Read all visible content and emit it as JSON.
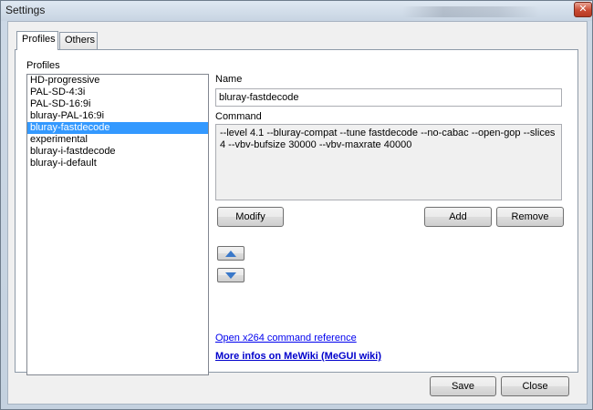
{
  "window": {
    "title": "Settings",
    "close_glyph": "✕"
  },
  "tabs": [
    {
      "label": "Profiles"
    },
    {
      "label": "Others"
    }
  ],
  "profiles_panel": {
    "group_label": "Profiles",
    "items": [
      "HD-progressive",
      "PAL-SD-4:3i",
      "PAL-SD-16:9i",
      "bluray-PAL-16:9i",
      "bluray-fastdecode",
      "experimental",
      "bluray-i-fastdecode",
      "bluray-i-default"
    ],
    "selected_index": 4
  },
  "editor": {
    "name_label": "Name",
    "name_value": "bluray-fastdecode",
    "command_label": "Command",
    "command_value": "--level 4.1 --bluray-compat --tune fastdecode --no-cabac --open-gop --slices 4 --vbv-bufsize 30000 --vbv-maxrate 40000"
  },
  "buttons": {
    "modify": "Modify",
    "add": "Add",
    "remove": "Remove",
    "save": "Save",
    "close": "Close"
  },
  "links": {
    "x264_reference": "Open x264 command reference",
    "wiki": "More infos on MeWiki (MeGUI wiki)"
  },
  "colors": {
    "selection": "#3399ff",
    "link": "#0000ee",
    "arrow": "#3a78c9"
  }
}
